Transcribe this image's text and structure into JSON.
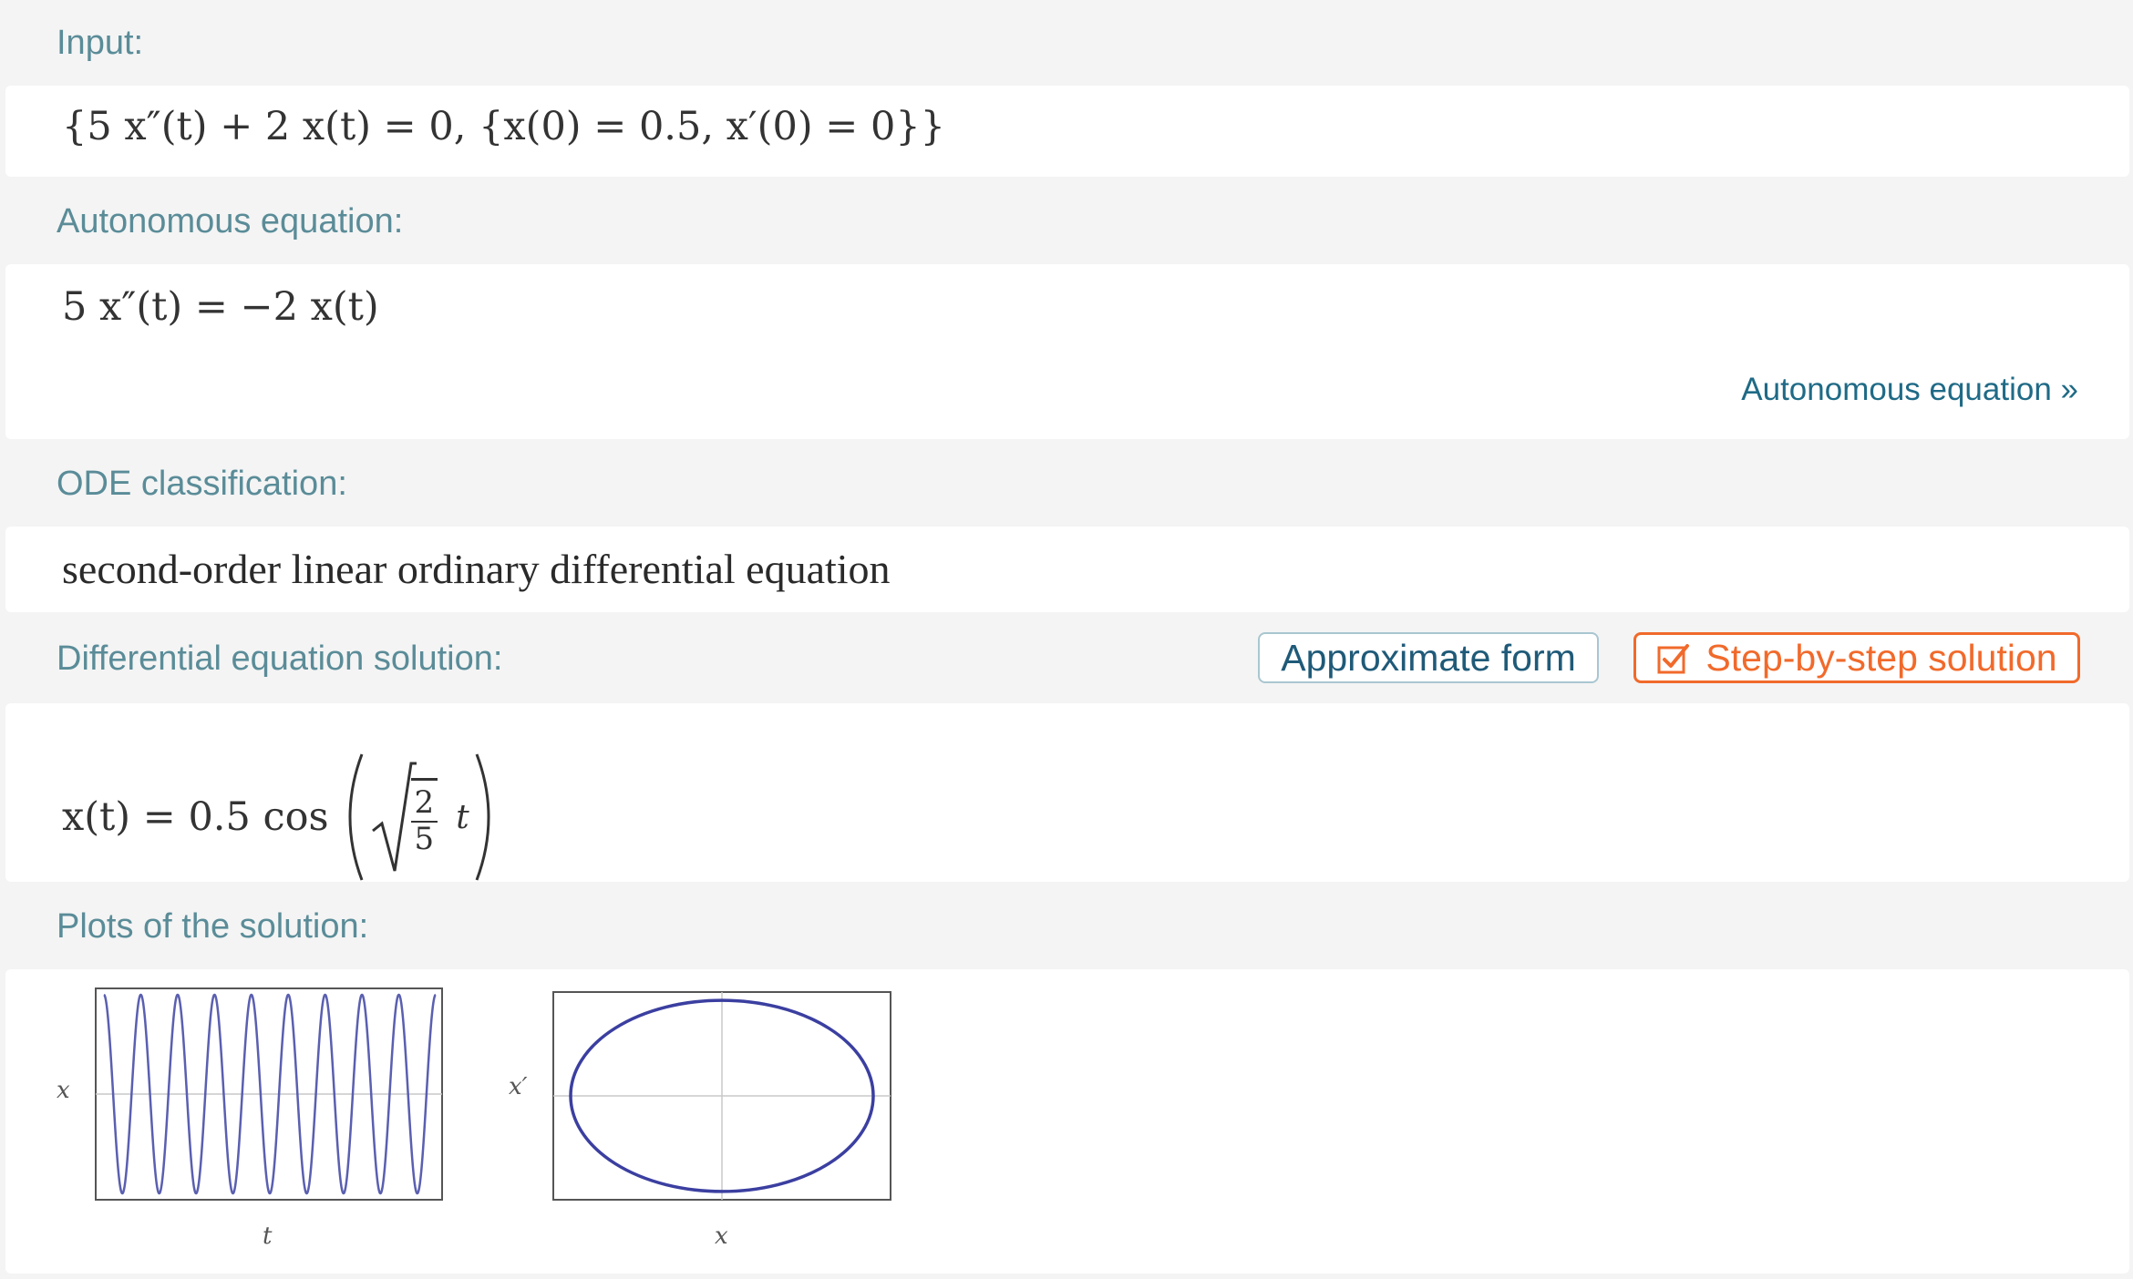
{
  "pods": {
    "input": {
      "title": "Input:",
      "expr": "{5 x″(t) + 2 x(t) = 0, {x(0) = 0.5, x′(0) = 0}}"
    },
    "autonomous": {
      "title": "Autonomous equation:",
      "expr": "5 x″(t) = −2 x(t)",
      "link": "Autonomous equation »"
    },
    "classification": {
      "title": "ODE classification:",
      "text": "second-order linear ordinary differential equation"
    },
    "solution": {
      "title": "Differential equation solution:",
      "approx_button": "Approximate form",
      "step_button": "Step-by-step solution",
      "expr_prefix": "x(t) = 0.5 cos",
      "frac_num": "2",
      "frac_den": "5",
      "expr_var": "t"
    },
    "plots": {
      "title": "Plots of the solution:"
    }
  },
  "colors": {
    "title": "#5a8c98",
    "link": "#1f6a86",
    "accent_orange": "#f16a2b",
    "plot_line": "#3b3fa0"
  },
  "icons": {
    "step_button_icon": "checkbox-icon"
  },
  "chart_data": [
    {
      "type": "line",
      "title": "",
      "xlabel": "t",
      "ylabel": "x",
      "function": "x(t) = 0.5 cos(sqrt(2/5) t)",
      "amplitude": 0.5,
      "omega": 0.6325,
      "oscillations": 9,
      "grid": true
    },
    {
      "type": "line",
      "title": "",
      "xlabel": "x",
      "ylabel": "x′",
      "curve": "ellipse",
      "x_semi_axis": 0.5,
      "y_semi_axis": 0.316,
      "grid": true
    }
  ]
}
